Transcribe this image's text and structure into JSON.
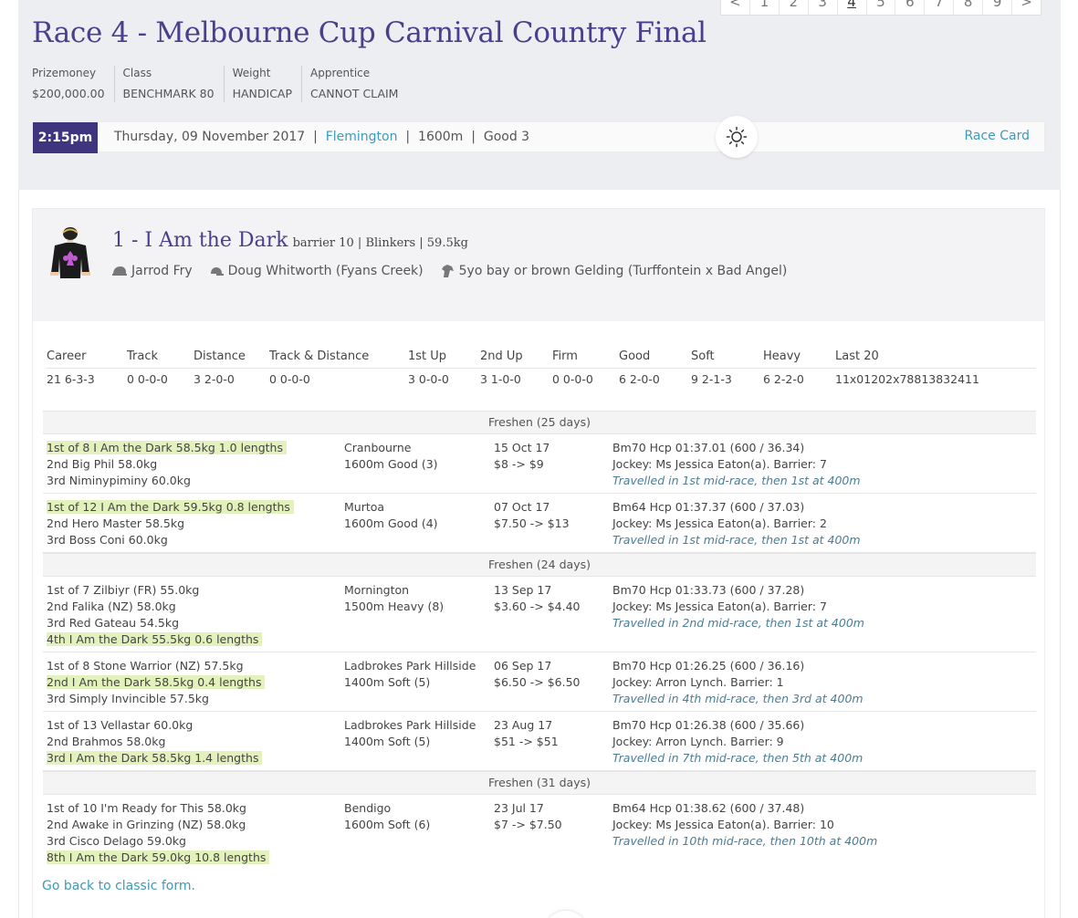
{
  "pager": {
    "items": [
      "<",
      "1",
      "2",
      "3",
      "4",
      "5",
      "6",
      "7",
      "8",
      "9",
      ">"
    ],
    "active": "4"
  },
  "race": {
    "title": "Race 4 - Melbourne Cup Carnival Country Final",
    "meta": [
      {
        "label": "Prizemoney",
        "value": "$200,000.00"
      },
      {
        "label": "Class",
        "value": "BENCHMARK 80"
      },
      {
        "label": "Weight",
        "value": "HANDICAP"
      },
      {
        "label": "Apprentice",
        "value": "CANNOT CLAIM"
      }
    ],
    "time": "2:15pm",
    "date": "Thursday, 09 November 2017",
    "venue": "Flemington",
    "distance": "1600m",
    "going": "Good 3",
    "sep": "|",
    "race_card": "Race Card"
  },
  "horse": {
    "name": "1 - I Am the Dark",
    "details": "barrier 10 | Blinkers | 59.5kg",
    "jockey": "Jarrod Fry",
    "trainer": "Doug Whitworth (Fyans Creek)",
    "breeding": "5yo bay or brown Gelding (Turffontein x Bad Angel)"
  },
  "stats": {
    "headers": [
      "Career",
      "Track",
      "Distance",
      "Track & Distance",
      "1st Up",
      "2nd Up",
      "Firm",
      "Good",
      "Soft",
      "Heavy",
      "Last 20"
    ],
    "values": [
      "21 6-3-3",
      "0 0-0-0",
      "3 2-0-0",
      "0 0-0-0",
      "3 0-0-0",
      "3 1-0-0",
      "0 0-0-0",
      "6 2-0-0",
      "9 2-1-3",
      "6 2-2-0",
      "11x01202x78813832411"
    ]
  },
  "runs": [
    {
      "freshen": "Freshen (25 days)"
    },
    {
      "placings": [
        "1st of 8 I Am the Dark 58.5kg 1.0 lengths",
        "2nd Big Phil 58.0kg",
        "3rd Niminypiminy 60.0kg"
      ],
      "hl": 0,
      "track": [
        "Cranbourne",
        "1600m Good (3)"
      ],
      "date": [
        "15 Oct 17",
        "$8 -> $9"
      ],
      "race": [
        "Bm70 Hcp 01:37.01 (600 / 36.34)",
        "Jockey: Ms Jessica Eaton(a). Barrier: 7",
        "Travelled in 1st mid-race, then 1st at 400m"
      ]
    },
    {
      "placings": [
        "1st of 12 I Am the Dark 59.5kg 0.8 lengths",
        "2nd Hero Master 58.5kg",
        "3rd Boss Coni 60.0kg"
      ],
      "hl": 0,
      "track": [
        "Murtoa",
        "1600m Good (4)"
      ],
      "date": [
        "07 Oct 17",
        "$7.50 -> $13"
      ],
      "race": [
        "Bm64 Hcp 01:37.37 (600 / 37.03)",
        "Jockey: Ms Jessica Eaton(a). Barrier: 2",
        "Travelled in 1st mid-race, then 1st at 400m"
      ]
    },
    {
      "freshen": "Freshen (24 days)"
    },
    {
      "placings": [
        "1st of 7 Zilbiyr (FR) 55.0kg",
        "2nd Falika (NZ) 58.0kg",
        "3rd Red Gateau 54.5kg",
        "4th I Am the Dark 55.5kg 0.6 lengths"
      ],
      "hl": 3,
      "track": [
        "Mornington",
        "1500m Heavy (8)"
      ],
      "date": [
        "13 Sep 17",
        "$3.60 -> $4.40"
      ],
      "race": [
        "Bm70 Hcp 01:33.73 (600 / 37.28)",
        "Jockey: Ms Jessica Eaton(a). Barrier: 7",
        "Travelled in 2nd mid-race, then 1st at 400m"
      ]
    },
    {
      "placings": [
        "1st of 8 Stone Warrior (NZ) 57.5kg",
        "2nd I Am the Dark 58.5kg 0.4 lengths",
        "3rd Simply Invincible 57.5kg"
      ],
      "hl": 1,
      "track": [
        "Ladbrokes Park Hillside",
        "1400m Soft (5)"
      ],
      "date": [
        "06 Sep 17",
        "$6.50 -> $6.50"
      ],
      "race": [
        "Bm70 Hcp 01:26.25 (600 / 36.16)",
        "Jockey: Arron Lynch. Barrier: 1",
        "Travelled in 4th mid-race, then 3rd at 400m"
      ]
    },
    {
      "placings": [
        "1st of 13 Vellastar 60.0kg",
        "2nd Brahmos 58.0kg",
        "3rd I Am the Dark 58.5kg 1.4 lengths"
      ],
      "hl": 2,
      "track": [
        "Ladbrokes Park Hillside",
        "1400m Soft (5)"
      ],
      "date": [
        "23 Aug 17",
        "$51 -> $51"
      ],
      "race": [
        "Bm70 Hcp 01:26.38 (600 / 35.66)",
        "Jockey: Arron Lynch. Barrier: 9",
        "Travelled in 7th mid-race, then 5th at 400m"
      ]
    },
    {
      "freshen": "Freshen (31 days)"
    },
    {
      "placings": [
        "1st of 10 I'm Ready for This 58.0kg",
        "2nd Awake in Grinzing (NZ) 58.0kg",
        "3rd Cisco Delago 59.0kg",
        "8th I Am the Dark 59.0kg 10.8 lengths"
      ],
      "hl": 3,
      "track": [
        "Bendigo",
        "1600m Soft (6)"
      ],
      "date": [
        "23 Jul 17",
        "$7 -> $7.50"
      ],
      "race": [
        "Bm64 Hcp 01:38.62 (600 / 37.48)",
        "Jockey: Ms Jessica Eaton(a). Barrier: 10",
        "Travelled in 10th mid-race, then 10th at 400m"
      ],
      "last": true
    }
  ],
  "back_link": "Go back to classic form.",
  "icons": {
    "weather": "sun-icon",
    "jockey": "helmet-icon",
    "trainer": "cap-icon",
    "breeding": "horse-head-icon"
  },
  "colors": {
    "brand": "#4a3f8c",
    "time_bg": "#3f357e",
    "link": "#3d9ab8",
    "highlight": "#e3f1bc"
  }
}
